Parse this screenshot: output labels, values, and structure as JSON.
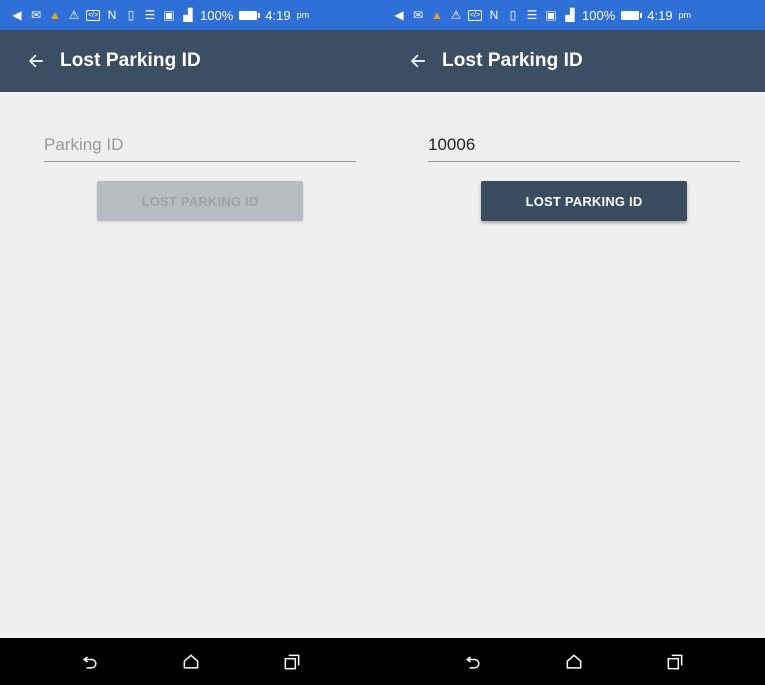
{
  "statusbar": {
    "battery_percent": "100%",
    "time": "4:19",
    "ampm": "pm",
    "icons": [
      "message-icon",
      "email-icon",
      "hazard-alert-icon",
      "warning-icon",
      "code-icon",
      "nfc-icon",
      "vibrate-icon",
      "wifi-icon",
      "sim-icon",
      "signal-icon",
      "battery-icon"
    ]
  },
  "screens": [
    {
      "title": "Lost Parking ID",
      "field": {
        "value": "",
        "placeholder": "Parking ID"
      },
      "button": {
        "label": "LOST PARKING ID",
        "state": "disabled"
      }
    },
    {
      "title": "Lost Parking ID",
      "field": {
        "value": "10006",
        "placeholder": "Parking ID"
      },
      "button": {
        "label": "LOST PARKING ID",
        "state": "enabled"
      }
    }
  ],
  "navbar": {
    "items": [
      "back-icon",
      "home-icon",
      "recents-icon"
    ]
  },
  "colors": {
    "status_bar": "#2f70d8",
    "app_bar": "#3c4e63",
    "background": "#efefef",
    "button_enabled": "#3a4c60",
    "button_disabled": "#b8bcc0"
  }
}
